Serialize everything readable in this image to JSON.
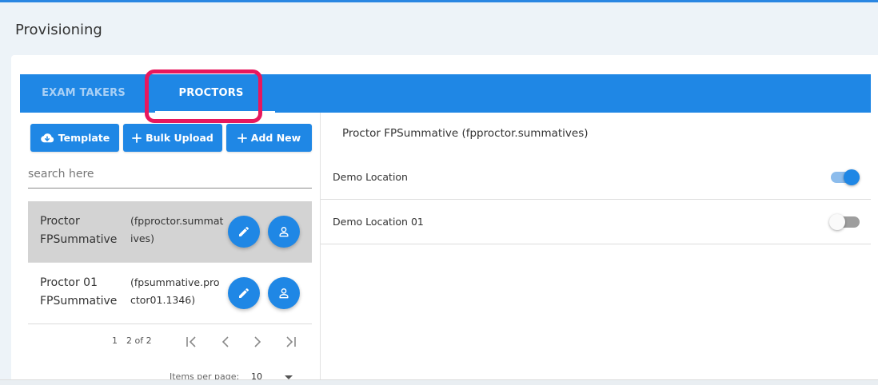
{
  "page": {
    "title": "Provisioning"
  },
  "tabs": [
    {
      "label": "EXAM TAKERS",
      "active": false
    },
    {
      "label": "PROCTORS",
      "active": true
    }
  ],
  "toolbar": {
    "template_label": "Template",
    "bulk_upload_label": "Bulk Upload",
    "add_new_label": "Add New"
  },
  "search": {
    "placeholder": "search here",
    "value": ""
  },
  "proctors": [
    {
      "name": "Proctor FPSummative",
      "username": "(fpproctor.summatives)",
      "selected": true
    },
    {
      "name": "Proctor 01 FPSummative",
      "username": "(fpsummative.proctor01.1346)",
      "selected": false
    }
  ],
  "pagination": {
    "page": "1",
    "range": "2 of 2",
    "items_per_page_label": "Items per page:",
    "items_per_page": "10"
  },
  "detail": {
    "title": "Proctor FPSummative (fpproctor.summatives)",
    "locations": [
      {
        "name": "Demo Location",
        "enabled": true
      },
      {
        "name": "Demo Location 01",
        "enabled": false
      }
    ]
  },
  "colors": {
    "primary": "#1f87e5",
    "highlight": "#e8175d",
    "selected_row": "#d3d3d3",
    "background": "#edf3f8"
  },
  "icons": {
    "template": "cloud-download-icon",
    "bulk_upload": "plus-icon",
    "add_new": "plus-icon",
    "edit": "pencil-icon",
    "assign": "person-icon",
    "first_page": "first-page-icon",
    "prev_page": "chevron-left-icon",
    "next_page": "chevron-right-icon",
    "last_page": "last-page-icon"
  }
}
